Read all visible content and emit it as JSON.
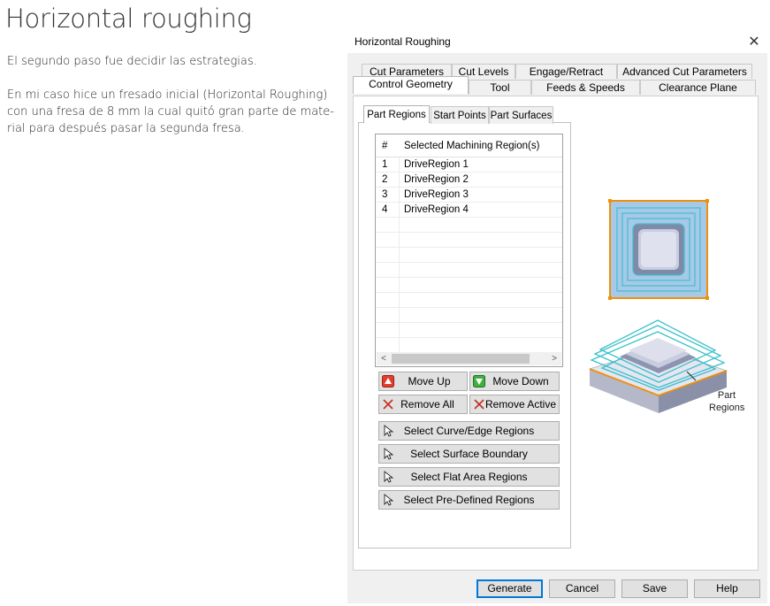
{
  "page": {
    "title": "Horizontal roughing",
    "paragraph1": [
      "El segundo paso fue decidir las estrategias."
    ],
    "paragraph2": [
      "En mi caso hice un fresado inicial (Horizontal Roughing)",
      "con una fresa de 8 mm la cual quitó gran parte de mate-",
      "rial para después pasar la segunda fresa."
    ]
  },
  "dialog": {
    "title": "Horizontal Roughing",
    "close_icon": "close-icon",
    "tabs_row1": [
      "Cut Parameters",
      "Cut Levels",
      "Engage/Retract",
      "Advanced Cut Parameters"
    ],
    "tabs_row2": [
      "Control Geometry",
      "Tool",
      "Feeds & Speeds",
      "Clearance Plane"
    ],
    "active_tab": "Control Geometry",
    "subtabs": [
      "Part Regions",
      "Start Points",
      "Part Surfaces"
    ],
    "active_subtab": "Part Regions",
    "list": {
      "col_num": "#",
      "col_name": "Selected Machining Region(s)",
      "rows": [
        {
          "num": "1",
          "name": "DriveRegion 1"
        },
        {
          "num": "2",
          "name": "DriveRegion 2"
        },
        {
          "num": "3",
          "name": "DriveRegion 3"
        },
        {
          "num": "4",
          "name": "DriveRegion 4"
        }
      ],
      "scroll_left": "<",
      "scroll_right": ">"
    },
    "buttons": {
      "move_up": "Move Up",
      "move_down": "Move Down",
      "remove_all": "Remove All",
      "remove_active": "Remove Active",
      "select_curve": "Select Curve/Edge Regions",
      "select_surface": "Select Surface Boundary",
      "select_flat": "Select Flat Area Regions",
      "select_predefined": "Select Pre-Defined Regions"
    },
    "illustration": {
      "label_line1": "Part",
      "label_line2": "Regions"
    },
    "footer": {
      "generate": "Generate",
      "cancel": "Cancel",
      "save": "Save",
      "help": "Help"
    },
    "colors": {
      "accent_orange": "#f0900a",
      "toolpath_cyan": "#3cc0cc",
      "up_red": "#e04030",
      "down_green": "#40b040"
    }
  }
}
